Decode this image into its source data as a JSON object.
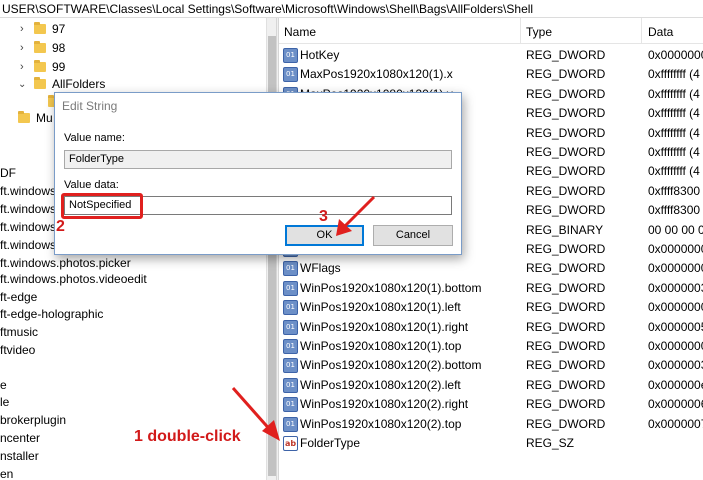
{
  "address": "USER\\SOFTWARE\\Classes\\Local Settings\\Software\\Microsoft\\Windows\\Shell\\Bags\\AllFolders\\Shell",
  "tree": {
    "folders": [
      {
        "label": "97"
      },
      {
        "label": "98"
      },
      {
        "label": "99"
      },
      {
        "label": "AllFolders"
      },
      {
        "label": ""
      },
      {
        "label": "Mu"
      }
    ],
    "items": [
      "DF",
      "ft.windows",
      "ft.windows",
      "ft.windows",
      "ft.windows",
      "ft.windows.photos.picker",
      "ft.windows.photos.videoedit",
      "ft-edge",
      "ft-edge-holographic",
      "ftmusic",
      "ftvideo",
      "",
      "e",
      "le",
      "brokerplugin",
      "ncenter",
      "nstaller",
      "en"
    ]
  },
  "list": {
    "headers": {
      "name": "Name",
      "type": "Type",
      "data": "Data"
    },
    "rows": [
      {
        "name": "HotKey",
        "type": "REG_DWORD",
        "data": "0x0000000",
        "icon": "binary-value-icon"
      },
      {
        "name": "MaxPos1920x1080x120(1).x",
        "type": "REG_DWORD",
        "data": "0xffffffff (4",
        "icon": "binary-value-icon"
      },
      {
        "name": "MaxPos1920x1080x120(1).y",
        "type": "REG_DWORD",
        "data": "0xffffffff (4",
        "icon": "binary-value-icon"
      },
      {
        "name": "",
        "type": "REG_DWORD",
        "data": "0xffffffff (4",
        "icon": "binary-value-icon"
      },
      {
        "name": "",
        "type": "REG_DWORD",
        "data": "0xffffffff (4",
        "icon": "binary-value-icon"
      },
      {
        "name": "",
        "type": "REG_DWORD",
        "data": "0xffffffff (4",
        "icon": "binary-value-icon"
      },
      {
        "name": "",
        "type": "REG_DWORD",
        "data": "0xffffffff (4",
        "icon": "binary-value-icon"
      },
      {
        "name": "",
        "type": "REG_DWORD",
        "data": "0xffff8300",
        "icon": "binary-value-icon"
      },
      {
        "name": "",
        "type": "REG_DWORD",
        "data": "0xffff8300",
        "icon": "binary-value-icon"
      },
      {
        "name": "",
        "type": "REG_BINARY",
        "data": "00 00 00 0",
        "icon": "binary-value-icon"
      },
      {
        "name": "",
        "type": "REG_DWORD",
        "data": "0x0000000",
        "icon": "binary-value-icon"
      },
      {
        "name": "WFlags",
        "type": "REG_DWORD",
        "data": "0x0000000",
        "icon": "binary-value-icon"
      },
      {
        "name": "WinPos1920x1080x120(1).bottom",
        "type": "REG_DWORD",
        "data": "0x0000003",
        "icon": "binary-value-icon"
      },
      {
        "name": "WinPos1920x1080x120(1).left",
        "type": "REG_DWORD",
        "data": "0x0000000",
        "icon": "binary-value-icon"
      },
      {
        "name": "WinPos1920x1080x120(1).right",
        "type": "REG_DWORD",
        "data": "0x0000005",
        "icon": "binary-value-icon"
      },
      {
        "name": "WinPos1920x1080x120(1).top",
        "type": "REG_DWORD",
        "data": "0x0000000",
        "icon": "binary-value-icon"
      },
      {
        "name": "WinPos1920x1080x120(2).bottom",
        "type": "REG_DWORD",
        "data": "0x0000003a",
        "icon": "binary-value-icon"
      },
      {
        "name": "WinPos1920x1080x120(2).left",
        "type": "REG_DWORD",
        "data": "0x000000e",
        "icon": "binary-value-icon"
      },
      {
        "name": "WinPos1920x1080x120(2).right",
        "type": "REG_DWORD",
        "data": "0x0000006",
        "icon": "binary-value-icon"
      },
      {
        "name": "WinPos1920x1080x120(2).top",
        "type": "REG_DWORD",
        "data": "0x0000007",
        "icon": "binary-value-icon"
      },
      {
        "name": "FolderType",
        "type": "REG_SZ",
        "data": "",
        "icon": "string-value-icon"
      }
    ]
  },
  "dialog": {
    "title": "Edit String",
    "value_name_label": "Value name:",
    "value_name": "FolderType",
    "value_data_label": "Value data:",
    "value_data": "NotSpecified",
    "ok_label": "OK",
    "cancel_label": "Cancel"
  },
  "annotations": {
    "step1": "1 double-click",
    "step2": "2",
    "step3": "3",
    "color": "#d21a1a"
  }
}
